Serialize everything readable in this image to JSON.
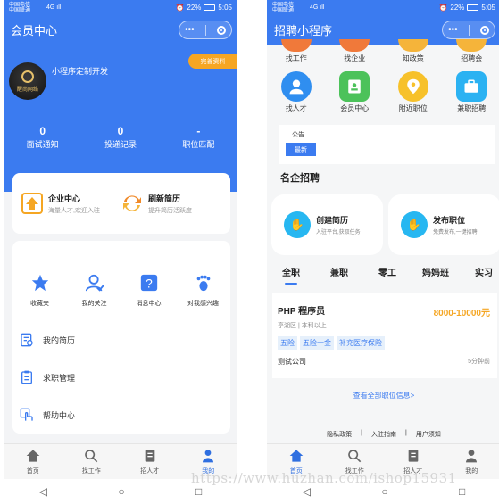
{
  "status": {
    "carrier1": "中国电信",
    "carrier2": "中国联通",
    "signal": "4G ıll",
    "battery": "22%",
    "time": "5:05"
  },
  "capsule": {
    "more": "•••"
  },
  "left": {
    "title": "会员中心",
    "user_name": "小程序定制开发",
    "avatar_text": "醒尚网络",
    "complete_button": "完善资料",
    "stats": [
      {
        "value": "0",
        "label": "面试通知"
      },
      {
        "value": "0",
        "label": "投递记录"
      },
      {
        "value": "-",
        "label": "职位匹配"
      }
    ],
    "entries": [
      {
        "title": "企业中心",
        "subtitle": "海量人才,欢迎入驻",
        "icon": "upload-icon"
      },
      {
        "title": "刷新简历",
        "subtitle": "提升简历活跃度",
        "icon": "refresh-icon"
      }
    ],
    "grid": [
      {
        "label": "收藏夹",
        "icon": "star-icon"
      },
      {
        "label": "我的关注",
        "icon": "user-follow-icon"
      },
      {
        "label": "消息中心",
        "icon": "question-icon"
      },
      {
        "label": "对我感兴趣",
        "icon": "footprint-icon"
      }
    ],
    "menu": [
      {
        "label": "我的简历",
        "icon": "resume-icon"
      },
      {
        "label": "求职管理",
        "icon": "clipboard-icon"
      },
      {
        "label": "帮助中心",
        "icon": "hand-icon"
      }
    ]
  },
  "tabbar": [
    {
      "label": "首页",
      "icon": "home-icon"
    },
    {
      "label": "找工作",
      "icon": "search-icon"
    },
    {
      "label": "招人才",
      "icon": "document-icon"
    },
    {
      "label": "我的",
      "icon": "person-icon"
    }
  ],
  "android_nav": {
    "back": "◁",
    "home": "○",
    "recent": "□"
  },
  "right": {
    "title": "招聘小程序",
    "icons_row1": [
      {
        "label": "找工作",
        "color": "#f0793a"
      },
      {
        "label": "找企业",
        "color": "#f0793a"
      },
      {
        "label": "知政策",
        "color": "#f5b43a"
      },
      {
        "label": "招聘会",
        "color": "#f5b43a"
      }
    ],
    "icons_row2": [
      {
        "label": "找人才",
        "color": "#2f8ef0"
      },
      {
        "label": "会员中心",
        "color": "#4cc25a"
      },
      {
        "label": "附近职位",
        "color": "#f7c12a"
      },
      {
        "label": "兼职招聘",
        "color": "#2bb2f2"
      }
    ],
    "notice": {
      "label": "公告",
      "tag": "最新"
    },
    "section_title": "名企招聘",
    "promos": [
      {
        "title": "创建简历",
        "subtitle": "入驻平台,获取任务"
      },
      {
        "title": "发布职位",
        "subtitle": "免费发布,一键招聘"
      }
    ],
    "job_tabs": [
      "全职",
      "兼职",
      "零工",
      "妈妈班",
      "实习"
    ],
    "job": {
      "name": "PHP 程序员",
      "salary": "8000-10000元",
      "meta": "亭湖区 | 本科以上",
      "tags": [
        "五险",
        "五险一金",
        "补充医疗保险"
      ],
      "company": "测试公司",
      "time": "5分钟前"
    },
    "view_all": "查看全部职位信息>",
    "footer": [
      "隐私政策",
      "|",
      "入驻指南",
      "|",
      "用户须知"
    ]
  },
  "watermark": "https://www.huzhan.com/ishop15931"
}
